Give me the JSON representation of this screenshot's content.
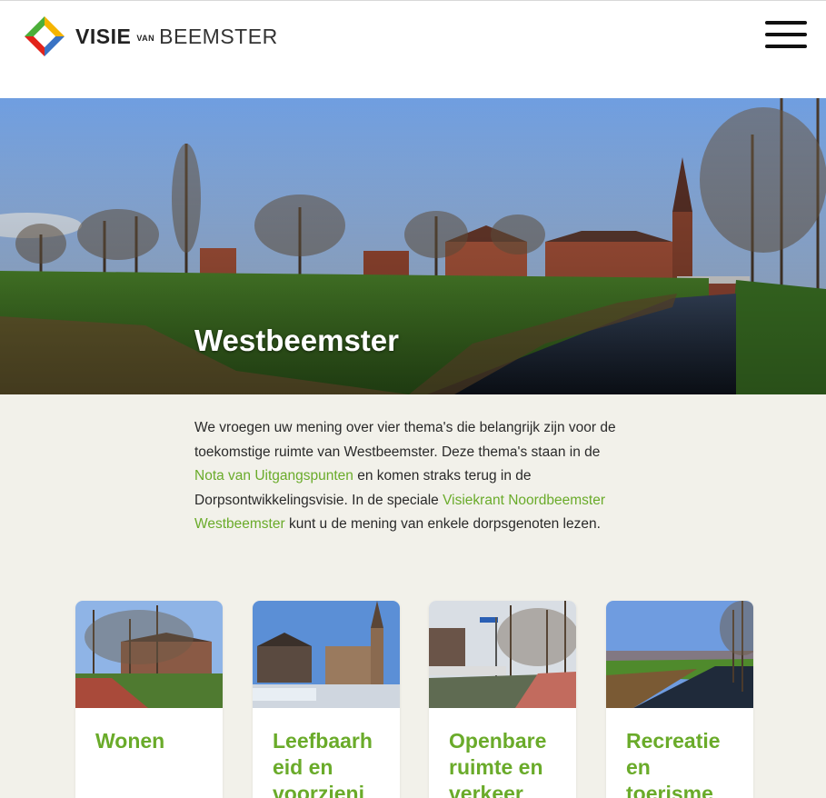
{
  "header": {
    "brand_main": "VISIE",
    "brand_small": "VAN",
    "brand_end": "BEEMSTER"
  },
  "hero": {
    "title": "Westbeemster"
  },
  "intro": {
    "text_1": "We vroegen uw mening over vier thema's die belangrijk zijn voor de toekomstige ruimte van Westbeemster. Deze thema's staan in de ",
    "link_1": "Nota van Uitgangspunten",
    "text_2": " en komen straks terug in de Dorpsontwikkelingsvisie. In de speciale ",
    "link_2": "Visiekrant Noordbeemster Westbeemster",
    "text_3": " kunt u de mening van enkele dorpsgenoten lezen."
  },
  "cards": [
    {
      "title": "Wonen"
    },
    {
      "title": "Leefbaarh\neid en\nvoorzieni"
    },
    {
      "title": "Openbare\nruimte en\nverkeer"
    },
    {
      "title": "Recreatie\nen\ntoerisme"
    }
  ],
  "colors": {
    "accent": "#6aab2a",
    "background": "#f2f1ea"
  }
}
